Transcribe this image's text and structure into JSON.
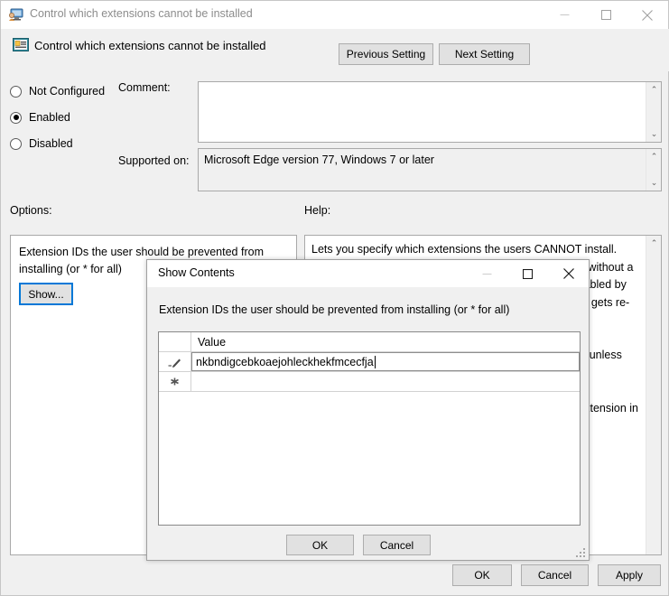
{
  "window": {
    "title": "Control which extensions cannot be installed",
    "icon": "policy-monitor-icon",
    "minimize_label": "—",
    "maximize_label": "□",
    "close_label": "✕"
  },
  "header": {
    "icon": "policy-setting-icon",
    "title": "Control which extensions cannot be installed",
    "previous_setting_label": "Previous Setting",
    "next_setting_label": "Next Setting"
  },
  "state": {
    "options": [
      {
        "label": "Not Configured",
        "checked": false
      },
      {
        "label": "Enabled",
        "checked": true
      },
      {
        "label": "Disabled",
        "checked": false
      }
    ]
  },
  "comment": {
    "label": "Comment:",
    "value": "",
    "scroll_up": "⌃",
    "scroll_down": "⌄"
  },
  "supported_on": {
    "label": "Supported on:",
    "value": "Microsoft Edge version 77, Windows 7 or later",
    "scroll_up": "⌃",
    "scroll_down": "⌄"
  },
  "options_pane": {
    "label": "Options:",
    "description": "Extension IDs the user should be prevented from installing (or * for all)",
    "show_button_label": "Show..."
  },
  "help_pane": {
    "label": "Help:",
    "text": "Lets you specify which extensions the users CANNOT install. Extensions already installed will be disabled if blocked, without a way for the user to enable them. After an extension disabled by this policy is removed from the blocklist, it automatically gets re-enabled.\n\nA blocklist value of '*' means all extensions are blocked unless they are explicitly listed in the allowlist.\n\nIf this policy is not configured the user can install any extension in Microsoft Edge.",
    "scroll_up": "⌃"
  },
  "footer": {
    "ok_label": "OK",
    "cancel_label": "Cancel",
    "apply_label": "Apply"
  },
  "modal": {
    "title": "Show Contents",
    "minimize_label": "—",
    "maximize_label": "□",
    "close_label": "✕",
    "subtitle": "Extension IDs the user should be prevented from installing (or * for all)",
    "grid": {
      "column_header": "Value",
      "rows": [
        {
          "indicator": "edit-pencil",
          "value": "nkbndigcebkoaejohleckhekfmcecfja",
          "editing": true
        },
        {
          "indicator": "new-row-asterisk",
          "value": "",
          "editing": false
        }
      ]
    },
    "ok_label": "OK",
    "cancel_label": "Cancel"
  }
}
